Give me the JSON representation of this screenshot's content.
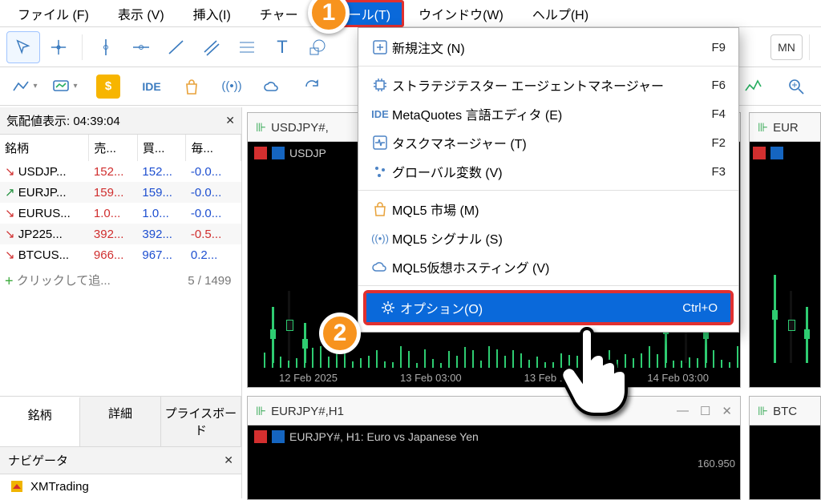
{
  "menubar": {
    "file": "ファイル (F)",
    "view": "表示 (V)",
    "insert": "挿入(I)",
    "chart": "チャー",
    "tools": "ツール(T)",
    "window": "ウインドウ(W)",
    "help": "ヘルプ(H)"
  },
  "timeframe_mn": "MN",
  "toolbar_ide": "IDE",
  "market_watch": {
    "header": "気配値表示: 04:39:04",
    "columns": {
      "symbol": "銘柄",
      "bid": "売...",
      "ask": "買...",
      "daily": "毎..."
    },
    "add_label": "クリックして追...",
    "counter": "5 / 1499",
    "tabs": {
      "symbols": "銘柄",
      "details": "詳細",
      "priceboard": "プライスボード"
    },
    "rows": [
      {
        "dir": "down",
        "sym": "USDJP...",
        "bid": "152...",
        "ask": "152...",
        "chg": "-0.0..."
      },
      {
        "dir": "up",
        "sym": "EURJP...",
        "bid": "159...",
        "ask": "159...",
        "chg": "-0.0..."
      },
      {
        "dir": "down",
        "sym": "EURUS...",
        "bid": "1.0...",
        "ask": "1.0...",
        "chg": "-0.0..."
      },
      {
        "dir": "down",
        "sym": "JP225...",
        "bid": "392...",
        "ask": "392...",
        "chg": "-0.5..."
      },
      {
        "dir": "down",
        "sym": "BTCUS...",
        "bid": "966...",
        "ask": "967...",
        "chg": "0.2..."
      }
    ]
  },
  "navigator": {
    "header": "ナビゲータ",
    "row1": "XMTrading"
  },
  "charts": {
    "top": {
      "title": "USDJPY#,",
      "inner": "USDJP",
      "xaxis": [
        "12 Feb 2025",
        "13 Feb 03:00",
        "13 Feb 11:00",
        "14 Feb 03:00"
      ]
    },
    "bottom": {
      "title": "EURJPY#,H1",
      "inner": "EURJPY#, H1:  Euro vs Japanese Yen",
      "yval": "160.950"
    },
    "right_top": {
      "title": "EUR"
    },
    "right_bottom": {
      "title": "BTC"
    }
  },
  "tools_menu": {
    "items": [
      {
        "icon": "plus-box",
        "label": "新規注文 (N)",
        "short": "F9"
      },
      {
        "icon": "chip",
        "label": "ストラテジテスター エージェントマネージャー",
        "short": "F6"
      },
      {
        "icon": "ide",
        "label": "MetaQuotes 言語エディタ (E)",
        "short": "F4"
      },
      {
        "icon": "pulse",
        "label": "タスクマネージャー (T)",
        "short": "F2"
      },
      {
        "icon": "dots",
        "label": "グローバル変数 (V)",
        "short": "F3"
      },
      {
        "icon": "bag",
        "label": "MQL5 市場 (M)",
        "short": ""
      },
      {
        "icon": "signal",
        "label": "MQL5 シグナル (S)",
        "short": ""
      },
      {
        "icon": "cloud",
        "label": "MQL5仮想ホスティング (V)",
        "short": ""
      },
      {
        "icon": "gear",
        "label": "オプション(O)",
        "short": "Ctrl+O"
      }
    ]
  },
  "badges": {
    "one": "1",
    "two": "2"
  }
}
